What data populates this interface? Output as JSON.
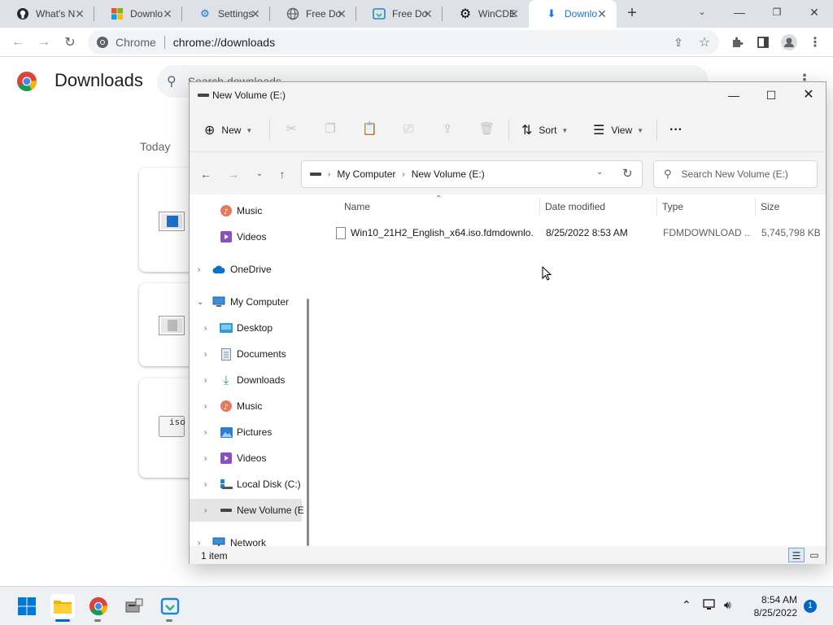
{
  "browser": {
    "tabs": [
      {
        "label": "What's N",
        "icon": "github-icon"
      },
      {
        "label": "Downlo",
        "icon": "windows-icon"
      },
      {
        "label": "Settings",
        "icon": "gear-icon"
      },
      {
        "label": "Free Do",
        "icon": "globe-icon"
      },
      {
        "label": "Free Do",
        "icon": "download-manager-icon"
      },
      {
        "label": "WinCDE",
        "icon": "cog-black-icon"
      },
      {
        "label": "Downlo",
        "icon": "download-icon"
      }
    ],
    "site_name": "Chrome",
    "url": "chrome://downloads",
    "accent": "#1a73e8"
  },
  "downloads_page": {
    "title": "Downloads",
    "search_placeholder": "Search downloads",
    "section_label": "Today",
    "card_icons": [
      "windows-file-icon",
      "generic-file-icon",
      "iso-file-icon"
    ],
    "iso_label": "iso"
  },
  "explorer": {
    "title": "New Volume (E:)",
    "commands": {
      "new_label": "New",
      "sort_label": "Sort",
      "view_label": "View"
    },
    "breadcrumbs": [
      "My Computer",
      "New Volume (E:)"
    ],
    "search_placeholder": "Search New Volume (E:)",
    "sidebar": [
      {
        "label": "Music",
        "icon": "music-icon",
        "level": 2,
        "expandable": false
      },
      {
        "label": "Videos",
        "icon": "videos-icon",
        "level": 2,
        "expandable": false
      },
      {
        "label": "OneDrive",
        "icon": "cloud-icon",
        "level": 1,
        "expandable": true
      },
      {
        "label": "My Computer",
        "icon": "computer-icon",
        "level": 1,
        "expandable": true,
        "expanded": true
      },
      {
        "label": "Desktop",
        "icon": "desktop-icon",
        "level": 2,
        "expandable": true
      },
      {
        "label": "Documents",
        "icon": "documents-icon",
        "level": 2,
        "expandable": true
      },
      {
        "label": "Downloads",
        "icon": "downloads-icon",
        "level": 2,
        "expandable": true
      },
      {
        "label": "Music",
        "icon": "music-icon",
        "level": 2,
        "expandable": true
      },
      {
        "label": "Pictures",
        "icon": "pictures-icon",
        "level": 2,
        "expandable": true
      },
      {
        "label": "Videos",
        "icon": "videos-icon",
        "level": 2,
        "expandable": true
      },
      {
        "label": "Local Disk (C:)",
        "icon": "local-disk-icon",
        "level": 2,
        "expandable": true
      },
      {
        "label": "New Volume (E",
        "icon": "drive-icon",
        "level": 2,
        "expandable": true,
        "selected": true
      },
      {
        "label": "Network",
        "icon": "network-icon",
        "level": 1,
        "expandable": true
      }
    ],
    "columns": [
      "Name",
      "Date modified",
      "Type",
      "Size"
    ],
    "files": [
      {
        "name": "Win10_21H2_English_x64.iso.fdmdownlo...",
        "date": "8/25/2022 8:53 AM",
        "type": "FDMDOWNLOAD ...",
        "size": "5,745,798 KB"
      }
    ],
    "status": "1 item"
  },
  "taskbar": {
    "apps": [
      "start-icon",
      "file-explorer-icon",
      "chrome-icon",
      "usb-tool-icon",
      "download-manager-icon"
    ],
    "time": "8:54 AM",
    "date": "8/25/2022",
    "notification_count": "1"
  }
}
